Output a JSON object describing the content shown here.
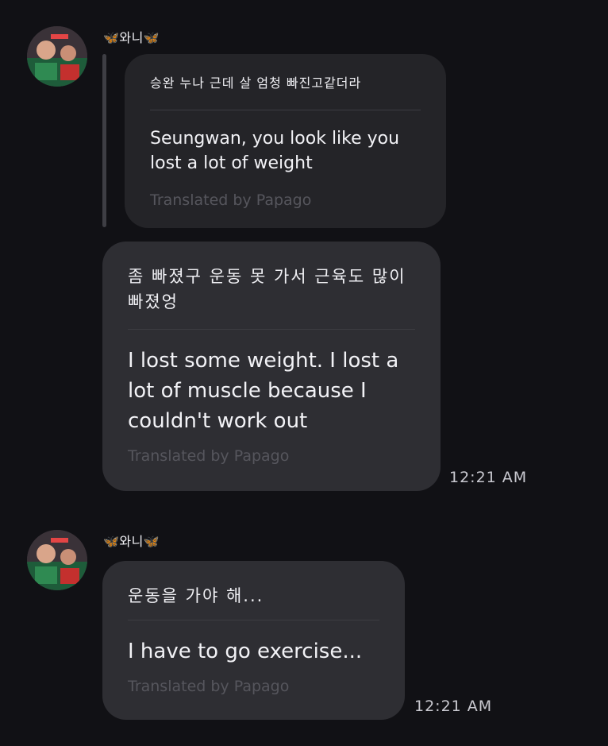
{
  "messages": [
    {
      "sender": "🦋와니🦋",
      "quoted": {
        "original": "승완 누나 근데 살 엄청 빠진고같더라",
        "translation": "Seungwan, you look like you lost a lot of weight",
        "credit": "Translated by Papago"
      },
      "original": "좀 빠졌구 운동 못 가서 근육도 많이 빠졌엉",
      "translation": "I lost some weight. I lost a lot of muscle because I couldn't work out",
      "credit": "Translated by Papago",
      "time": "12:21 AM"
    },
    {
      "sender": "🦋와니🦋",
      "original": "운동을 가야 해...",
      "translation": "I have to go exercise...",
      "credit": "Translated by Papago",
      "time": "12:21 AM"
    }
  ],
  "colors": {
    "background": "#111115",
    "bubble": "#2e2e33",
    "quoted_bubble": "#242428",
    "butterfly": "#34a7e8"
  },
  "icons": [
    "avatar",
    "butterfly-icon"
  ]
}
